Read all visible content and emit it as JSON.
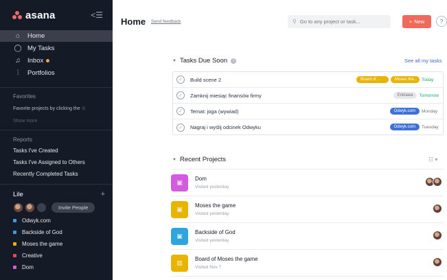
{
  "sidebar": {
    "logo": "asana",
    "nav": [
      {
        "label": "Home",
        "icon": "home-icon"
      },
      {
        "label": "My Tasks",
        "icon": "check-circle-icon"
      },
      {
        "label": "Inbox",
        "icon": "bell-icon"
      },
      {
        "label": "Portfolios",
        "icon": "bar-chart-icon"
      }
    ],
    "favorites": {
      "title": "Favorites",
      "hint": "Favorite projects by clicking the ☆",
      "show_more": "Show more"
    },
    "reports": {
      "title": "Reports",
      "items": [
        "Tasks I've Created",
        "Tasks I've Assigned to Others",
        "Recently Completed Tasks"
      ]
    },
    "team": {
      "name": "Lile",
      "invite_label": "Invite People",
      "projects": [
        {
          "label": "Odwyk.com",
          "color": "#3e9be0"
        },
        {
          "label": "Backside of God",
          "color": "#3e9be0"
        },
        {
          "label": "Moses the game",
          "color": "#e8b400"
        },
        {
          "label": "Creative",
          "color": "#f0405b"
        },
        {
          "label": "Dom",
          "color": "#d35be0"
        }
      ]
    }
  },
  "header": {
    "title": "Home",
    "feedback": "Send feedback",
    "search_placeholder": "Go to any project or task...",
    "new_label": "New",
    "help_label": "?"
  },
  "tasks_due": {
    "title": "Tasks Due Soon",
    "see_all": "See all my tasks",
    "tasks": [
      {
        "name": "Build scene 2",
        "tags": [
          {
            "label": "Board of ...",
            "style": "gold"
          },
          {
            "label": "Moses the...",
            "style": "gold2"
          }
        ],
        "due": "Today",
        "due_style": "green"
      },
      {
        "name": "Zamknij miesiąc finansów firmy",
        "tags": [
          {
            "label": "Enklawa",
            "style": "grey"
          }
        ],
        "due": "Tomorrow",
        "due_style": "green"
      },
      {
        "name": "Temat: joga (wywiad)",
        "tags": [
          {
            "label": "Odwyk.com",
            "style": "blue"
          }
        ],
        "due": "Monday",
        "due_style": ""
      },
      {
        "name": "Nagraj i wyślij odcinek Odwyku",
        "tags": [
          {
            "label": "Odwyk.com",
            "style": "blue"
          }
        ],
        "due": "Tuesday",
        "due_style": ""
      }
    ]
  },
  "recent_projects": {
    "title": "Recent Projects",
    "projects": [
      {
        "name": "Dom",
        "visited": "Visited yesterday",
        "color": "#d35be0",
        "avatars": 2
      },
      {
        "name": "Moses the game",
        "visited": "Visited yesterday",
        "color": "#e8b400",
        "avatars": 1
      },
      {
        "name": "Backside of God",
        "visited": "Visited yesterday",
        "color": "#2fa5e0",
        "avatars": 1
      },
      {
        "name": "Board of Moses the game",
        "visited": "Visited Nov 7",
        "color": "#e8b400",
        "avatars": 1
      }
    ]
  }
}
